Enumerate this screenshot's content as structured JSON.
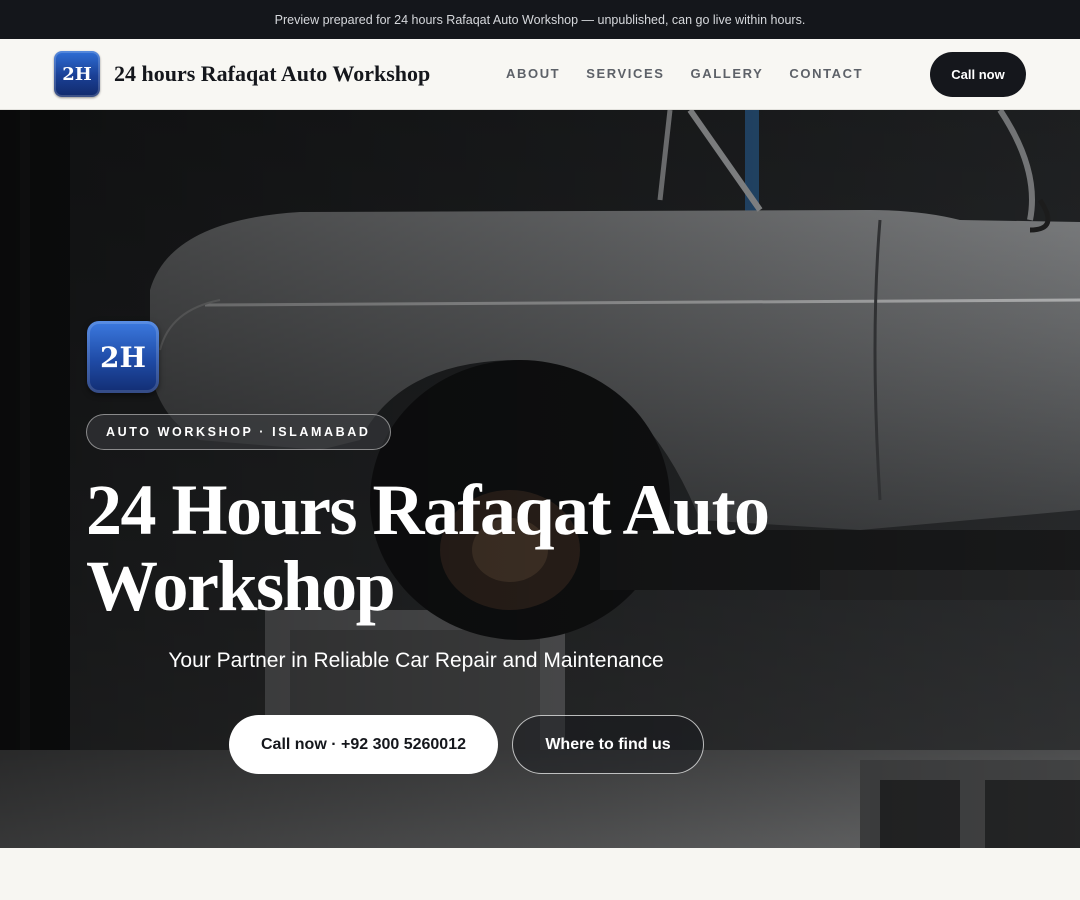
{
  "topbar": {
    "notice": "Preview prepared for 24 hours Rafaqat Auto Workshop — unpublished, can go live within hours."
  },
  "header": {
    "logo_text": "2H",
    "brand_name": "24 hours Rafaqat Auto Workshop",
    "nav": [
      "ABOUT",
      "SERVICES",
      "GALLERY",
      "CONTACT"
    ],
    "call_label": "Call now"
  },
  "hero": {
    "badge_text": "2H",
    "eyebrow": "AUTO WORKSHOP · ISLAMABAD",
    "title": "24 Hours Rafaqat Auto Workshop",
    "subtitle": "Your Partner in Reliable Car Repair and Maintenance",
    "primary_cta": "Call now · +92 300 5260012",
    "secondary_cta": "Where to find us"
  },
  "colors": {
    "topbar_bg": "#14161b",
    "header_bg": "#f8f7f3",
    "brand_dark": "#15171c",
    "logo_blue": "#1f4ba6"
  },
  "icons": {
    "logo": "logo-icon",
    "hero_image": "car-on-lift-photo"
  }
}
